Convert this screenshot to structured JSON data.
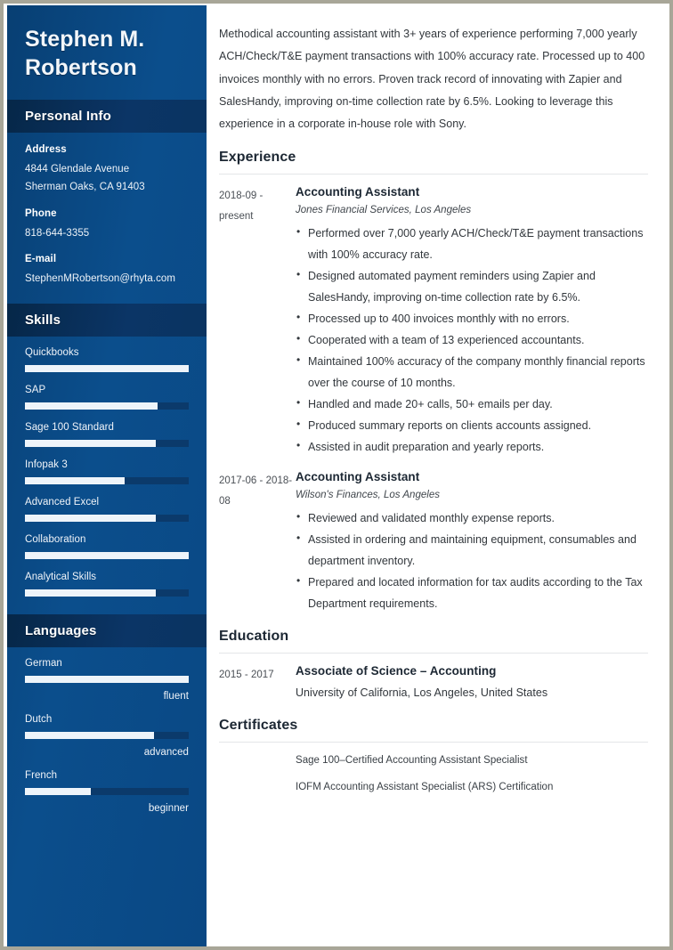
{
  "theme": {
    "sidebar_bg": "#0a4a85",
    "sidebar_header_bg": "#0a3461",
    "bar_fill": "#eef4fa",
    "bar_track": "#0b3a6b",
    "page_border": "#a8a698",
    "text_dark": "#32373c"
  },
  "sidebar": {
    "name": "Stephen M. Robertson",
    "personal_info": {
      "heading": "Personal Info",
      "groups": [
        {
          "label": "Address",
          "lines": [
            "4844 Glendale Avenue",
            "Sherman Oaks, CA 91403"
          ]
        },
        {
          "label": "Phone",
          "lines": [
            "818-644-3355"
          ]
        },
        {
          "label": "E-mail",
          "lines": [
            "StephenMRobertson@rhyta.com"
          ]
        }
      ]
    },
    "skills": {
      "heading": "Skills",
      "items": [
        {
          "label": "Quickbooks",
          "level": 100
        },
        {
          "label": "SAP",
          "level": 81
        },
        {
          "label": "Sage 100 Standard",
          "level": 80
        },
        {
          "label": "Infopak 3",
          "level": 61
        },
        {
          "label": "Advanced Excel",
          "level": 80
        },
        {
          "label": "Collaboration",
          "level": 100
        },
        {
          "label": "Analytical Skills",
          "level": 80
        }
      ]
    },
    "languages": {
      "heading": "Languages",
      "items": [
        {
          "label": "German",
          "level": 100,
          "proficiency": "fluent"
        },
        {
          "label": "Dutch",
          "level": 79,
          "proficiency": "advanced"
        },
        {
          "label": "French",
          "level": 40,
          "proficiency": "beginner"
        }
      ]
    }
  },
  "main": {
    "summary": "Methodical accounting assistant with 3+ years of experience performing 7,000 yearly ACH/Check/T&E payment transactions with 100% accuracy rate. Processed up to 400 invoices monthly with no errors. Proven track record of innovating with Zapier and SalesHandy, improving on-time collection rate by 6.5%. Looking to leverage this experience in a corporate in-house role with Sony.",
    "experience": {
      "heading": "Experience",
      "entries": [
        {
          "dates": "2018-09 - present",
          "title": "Accounting Assistant",
          "subtitle": "Jones Financial Services, Los Angeles",
          "bullets": [
            "Performed over 7,000 yearly ACH/Check/T&E payment transactions with 100% accuracy rate.",
            "Designed automated payment reminders using Zapier and SalesHandy, improving on-time collection rate by 6.5%.",
            "Processed up to 400 invoices monthly with no errors.",
            "Cooperated with a team of 13 experienced accountants.",
            "Maintained 100% accuracy of the company monthly financial reports over the course of 10 months.",
            "Handled and made 20+ calls, 50+ emails per day.",
            "Produced summary reports on clients accounts assigned.",
            "Assisted in audit preparation and yearly reports."
          ]
        },
        {
          "dates": "2017-06 - 2018-08",
          "title": "Accounting Assistant",
          "subtitle": "Wilson's Finances, Los Angeles",
          "bullets": [
            "Reviewed and validated monthly expense reports.",
            "Assisted in ordering and maintaining equipment, consumables and department inventory.",
            "Prepared and located information for tax audits according to the Tax Department requirements."
          ]
        }
      ]
    },
    "education": {
      "heading": "Education",
      "entries": [
        {
          "dates": "2015 - 2017",
          "title": "Associate of Science – Accounting",
          "school": "University of California, Los Angeles, United States"
        }
      ]
    },
    "certificates": {
      "heading": "Certificates",
      "items": [
        "Sage 100–Certified Accounting Assistant Specialist",
        "IOFM Accounting Assistant Specialist (ARS) Certification"
      ]
    }
  }
}
